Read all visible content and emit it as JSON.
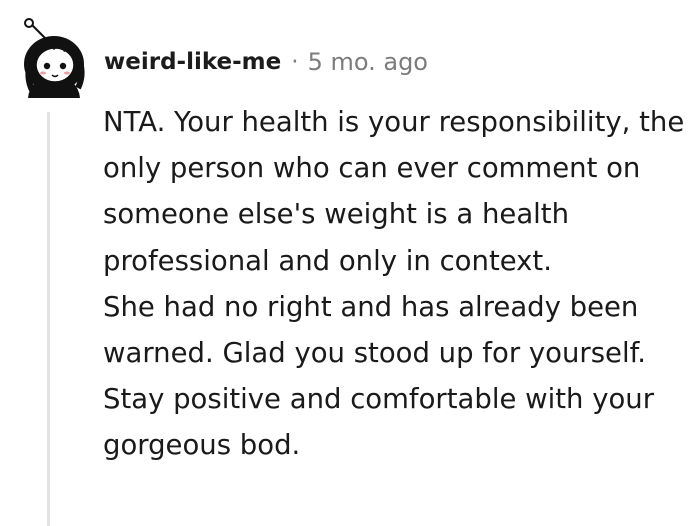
{
  "comment": {
    "author": "weird-like-me",
    "separator": "·",
    "timestamp": "5 mo. ago",
    "avatar_icon": "snoo-avatar-icon",
    "paragraphs": [
      "NTA. Your health is your responsibility, the only person who can ever comment on someone else's weight is a health professional and only in context.",
      "She had no right and has already been warned. Glad you stood up for yourself. Stay positive and comfortable with your gorgeous bod."
    ]
  },
  "colors": {
    "text": "#1a1a1b",
    "meta": "#7c7c7c",
    "thread_line": "#e3e3e3"
  }
}
